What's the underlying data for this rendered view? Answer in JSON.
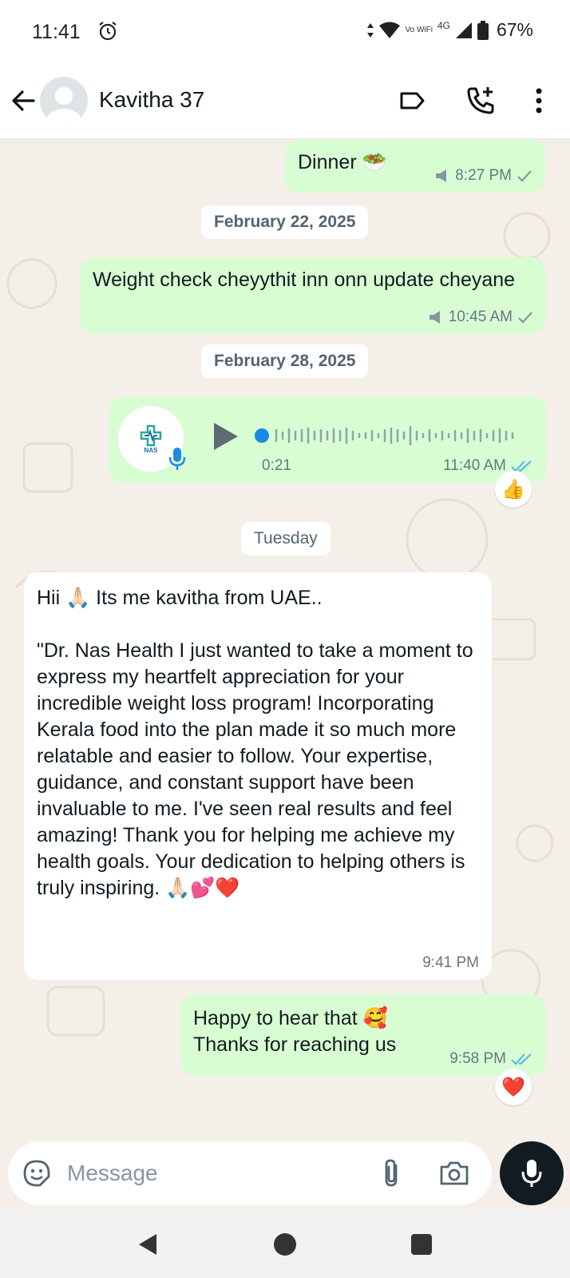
{
  "status_bar": {
    "time": "11:41",
    "network_label": "4G",
    "volte_label": "Vo WiFi",
    "battery": "67%"
  },
  "header": {
    "contact_name": "Kavitha 37",
    "icons": [
      "back-arrow-icon",
      "label-icon",
      "call-add-icon",
      "more-vert-icon"
    ]
  },
  "chat": {
    "messages": [
      {
        "direction": "outgoing",
        "text": "Dinner 🥗",
        "time": "8:27 PM",
        "status": "sent"
      },
      {
        "direction": "outgoing",
        "text": "Weight check cheyythit inn onn update cheyane",
        "time": "10:45 AM",
        "status": "sent"
      },
      {
        "direction": "outgoing",
        "type": "voice",
        "avatar_label": "NAS",
        "duration": "0:21",
        "time": "11:40 AM",
        "status": "read",
        "reaction": "👍"
      },
      {
        "direction": "incoming",
        "text": "Hii 🙏🏻 Its me kavitha from UAE..\n\n\"Dr. Nas Health I just wanted to take a moment to express my heartfelt appreciation for your incredible weight loss program! Incorporating Kerala food into the plan made it so much more relatable and easier to follow. Your expertise, guidance, and constant support have been invaluable to me. I've seen real results and feel amazing! Thank you for helping me achieve my health goals. Your dedication to helping others is truly inspiring. 🙏🏻💕❤️",
        "time": "9:41 PM"
      },
      {
        "direction": "outgoing",
        "text": "Happy to hear that 🥰\nThanks for reaching us",
        "time": "9:58 PM",
        "status": "read",
        "reaction": "❤️"
      }
    ],
    "dates": [
      "February 22, 2025",
      "February 28, 2025",
      "Tuesday"
    ]
  },
  "input": {
    "placeholder": "Message"
  },
  "colors": {
    "outgoing_bubble": "#d9fdd3",
    "incoming_bubble": "#ffffff",
    "chat_background": "#f4efe8",
    "read_tick": "#53bdeb"
  }
}
